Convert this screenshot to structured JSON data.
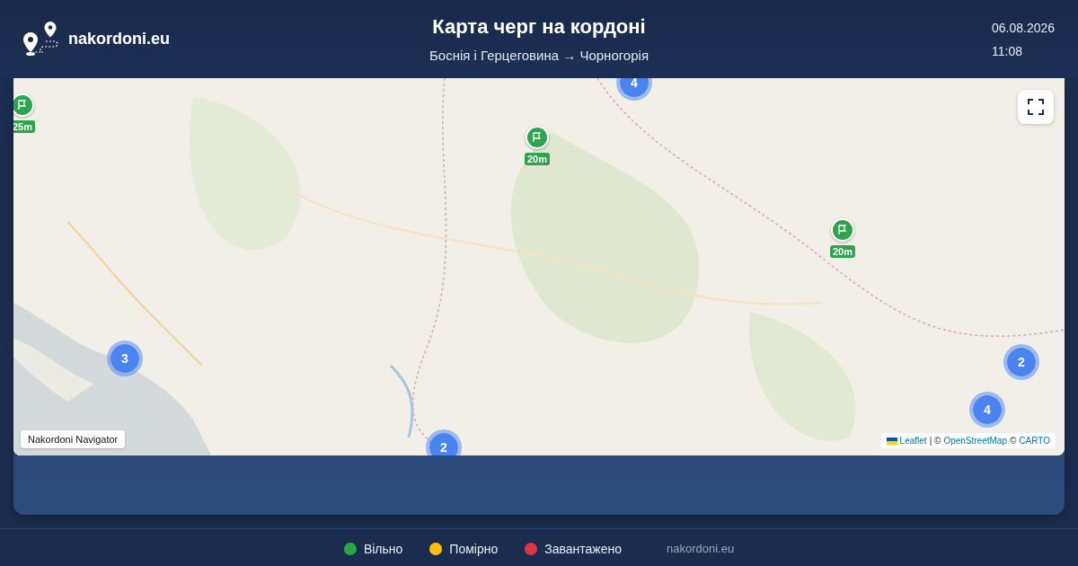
{
  "header": {
    "brand": "nakordoni.eu",
    "title": "Карта черг на кордоні",
    "route": "Боснія і Герцеговина → Чорногорія",
    "date": "06.08.2026",
    "time": "11:08"
  },
  "map": {
    "markers": [
      {
        "kind": "flag",
        "label": "25m"
      },
      {
        "kind": "flag",
        "label": "20m"
      },
      {
        "kind": "flag",
        "label": "20m"
      },
      {
        "kind": "cluster",
        "label": "4"
      },
      {
        "kind": "cluster",
        "label": "3"
      },
      {
        "kind": "cluster",
        "label": "2"
      },
      {
        "kind": "cluster",
        "label": "2"
      },
      {
        "kind": "cluster",
        "label": "4"
      }
    ],
    "badge": "Nakordoni Navigator",
    "attribution": [
      {
        "kind": "link",
        "text": "Leaflet"
      },
      {
        "kind": "text",
        "text": "| ©"
      },
      {
        "kind": "link",
        "text": "OpenStreetMap"
      },
      {
        "kind": "text",
        "text": "©"
      },
      {
        "kind": "link",
        "text": "CARTO"
      }
    ]
  },
  "legend": [
    {
      "label": "Вільно",
      "color": "#28a745"
    },
    {
      "label": "Помірно",
      "color": "#ffc107"
    },
    {
      "label": "Завантажено",
      "color": "#dc3545"
    }
  ],
  "footer_site": "nakordoni.eu"
}
